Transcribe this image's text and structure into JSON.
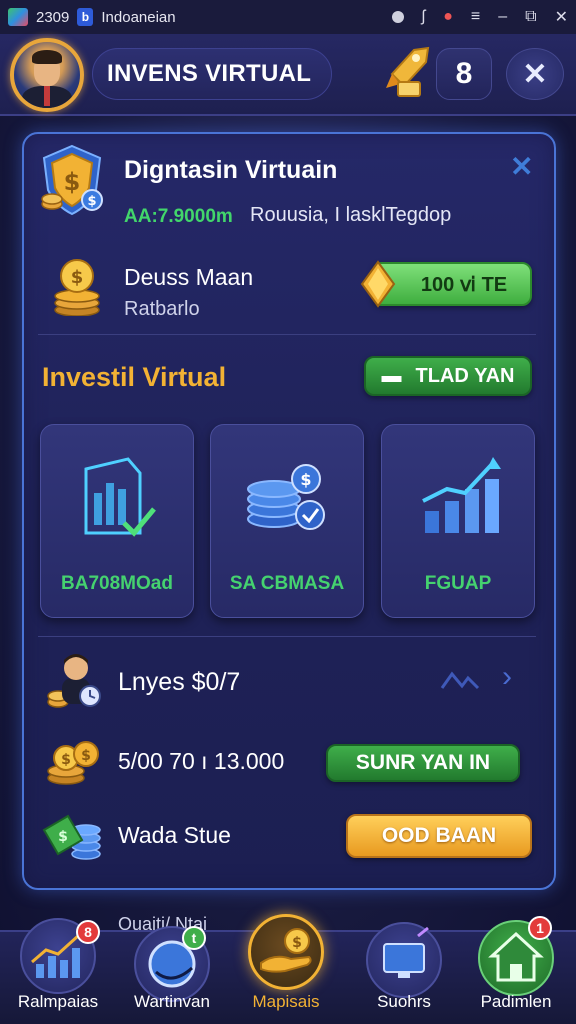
{
  "status_bar": {
    "time": "2309",
    "app_name": "Indoaneian",
    "right_icons": [
      "settings-icon",
      "signal-icon",
      "notification-icon",
      "menu-icon",
      "window-icon",
      "close-icon"
    ]
  },
  "header": {
    "title": "INVENS VIRTUAL",
    "count_button": "8",
    "close_button": "✕"
  },
  "card": {
    "title": "Digntasin Virtuain",
    "amount": "AA:7.9000m",
    "description": "Rouusia,  I lasklTegdop",
    "close": "✕"
  },
  "balance_row": {
    "label": "Deuss Maan",
    "sub": "Ratbarlo",
    "button": "100 ⅵ TE"
  },
  "section": {
    "title": "Investil Virtual",
    "button": "TLAD YAN"
  },
  "tiles": [
    {
      "label": "BA708MOad"
    },
    {
      "label": "SA CBMASA"
    },
    {
      "label": "FGUAP"
    }
  ],
  "list_rows": [
    {
      "label": "Lnyes $0/7"
    },
    {
      "label": "5/00 70 ı 13.000",
      "button": "SUNR YAN IN"
    },
    {
      "label": "Wada Stue",
      "button": "OOD BAAN"
    }
  ],
  "peek_text": "Ouaiti/ Ntai",
  "bottom_nav": [
    {
      "label": "Ralmpaias",
      "badge": "8"
    },
    {
      "label": "Wartinvan",
      "badge": "t"
    },
    {
      "label": "Mapisais",
      "badge": ""
    },
    {
      "label": "Suohrs",
      "badge": ""
    },
    {
      "label": "Padimlen",
      "badge": "1"
    }
  ],
  "colors": {
    "accent_blue": "#4a74d6",
    "green": "#45d26f",
    "gold": "#f2b234",
    "orange": "#e89a20"
  }
}
